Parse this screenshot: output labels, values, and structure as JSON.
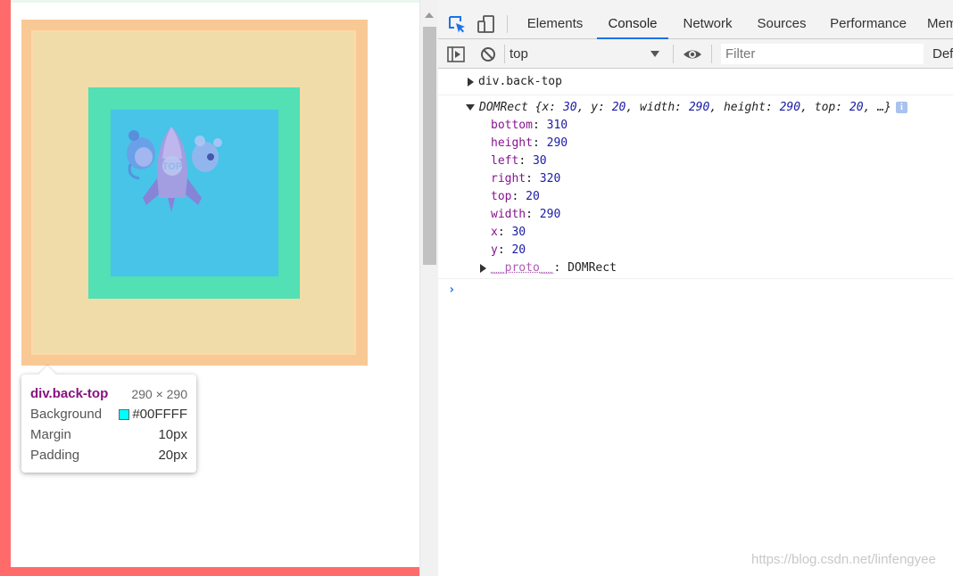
{
  "page": {
    "highlight_colors": {
      "margin": "#f8c994",
      "border": "#ffd9a8",
      "padding": "#52e0b4",
      "content": "#47c4e8"
    },
    "image_label": "TOP"
  },
  "tooltip": {
    "element": "div.back-top",
    "size": "290 × 290",
    "rows": [
      {
        "label": "Background",
        "value": "#00FFFF",
        "swatch": "#00ffff"
      },
      {
        "label": "Margin",
        "value": "10px"
      },
      {
        "label": "Padding",
        "value": "20px"
      }
    ]
  },
  "devtools": {
    "tabs": [
      "Elements",
      "Console",
      "Network",
      "Sources",
      "Performance",
      "Mem"
    ],
    "active_tab": "Console",
    "context": "top",
    "filter_placeholder": "Filter",
    "levels_label": "Def"
  },
  "console": {
    "entry1": "div.back-top",
    "entry2_type": "DOMRect",
    "entry2_summary": "{x: 30, y: 20, width: 290, height: 290, top: 20, …}",
    "info_badge": "i",
    "props": [
      {
        "key": "bottom",
        "value": "310"
      },
      {
        "key": "height",
        "value": "290"
      },
      {
        "key": "left",
        "value": "30"
      },
      {
        "key": "right",
        "value": "320"
      },
      {
        "key": "top",
        "value": "20"
      },
      {
        "key": "width",
        "value": "290"
      },
      {
        "key": "x",
        "value": "30"
      },
      {
        "key": "y",
        "value": "20"
      }
    ],
    "proto_key": "__proto__",
    "proto_value": "DOMRect",
    "prompt": "›"
  },
  "watermark": "https://blog.csdn.net/linfengyee"
}
